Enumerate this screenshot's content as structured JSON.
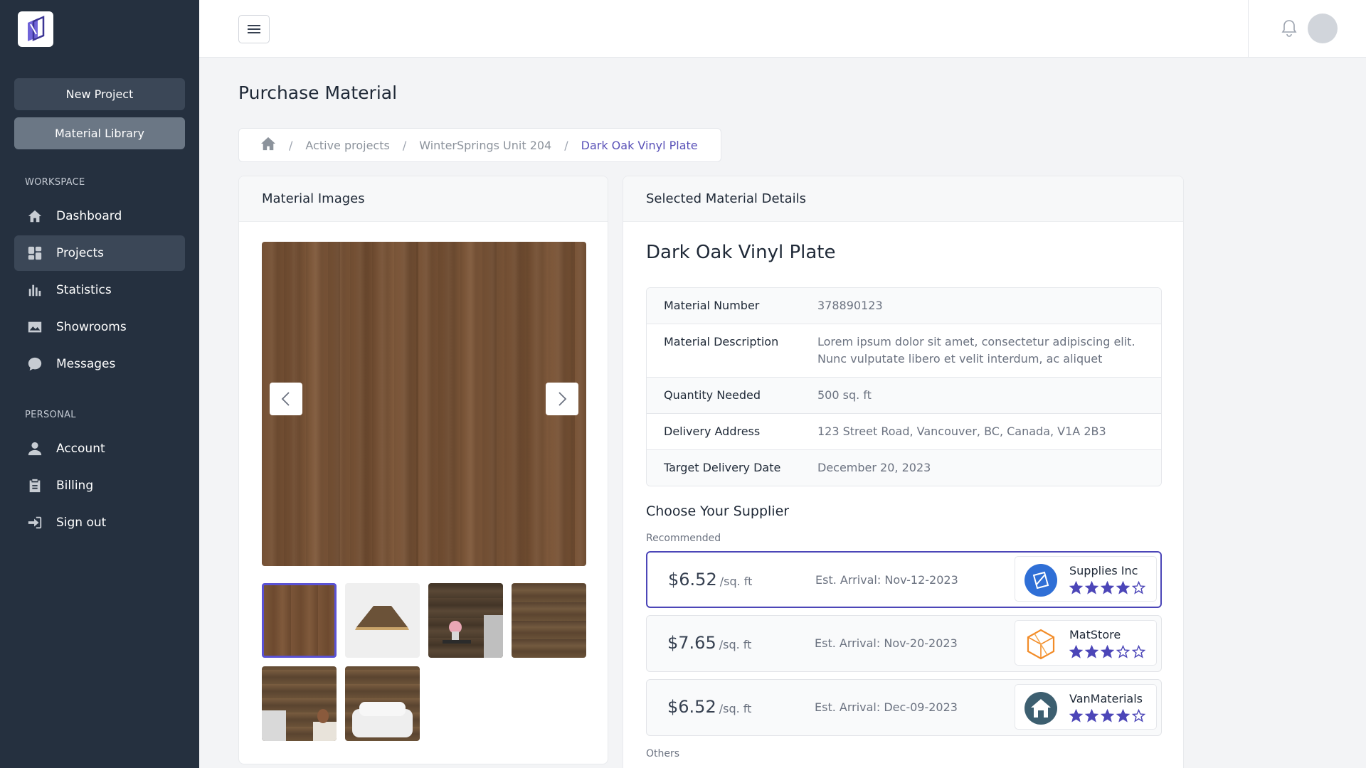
{
  "sidebar": {
    "buttons": {
      "new_project": "New Project",
      "material_library": "Material Library"
    },
    "sections": {
      "workspace": "WORKSPACE",
      "personal": "PERSONAL"
    },
    "workspace_items": [
      {
        "label": "Dashboard",
        "icon": "home-icon"
      },
      {
        "label": "Projects",
        "icon": "projects-icon",
        "active": true
      },
      {
        "label": "Statistics",
        "icon": "bar-chart-icon"
      },
      {
        "label": "Showrooms",
        "icon": "image-icon"
      },
      {
        "label": "Messages",
        "icon": "chat-icon"
      }
    ],
    "personal_items": [
      {
        "label": "Account",
        "icon": "user-icon"
      },
      {
        "label": "Billing",
        "icon": "clipboard-icon"
      },
      {
        "label": "Sign out",
        "icon": "sign-out-icon"
      }
    ]
  },
  "page": {
    "title": "Purchase Material",
    "breadcrumb": [
      "Active projects",
      "WinterSprings Unit 204",
      "Dark Oak Vinyl Plate"
    ]
  },
  "images_card": {
    "title": "Material Images"
  },
  "details_card": {
    "title": "Selected Material Details",
    "material_name": "Dark Oak Vinyl Plate",
    "rows": [
      {
        "key": "Material Number",
        "value": "378890123"
      },
      {
        "key": "Material Description",
        "value": "Lorem ipsum dolor sit amet, consectetur adipiscing elit. Nunc vulputate libero et velit interdum, ac aliquet"
      },
      {
        "key": "Quantity Needed",
        "value": "500 sq. ft"
      },
      {
        "key": "Delivery Address",
        "value": "123 Street Road, Vancouver, BC, Canada, V1A 2B3"
      },
      {
        "key": "Target Delivery Date",
        "value": "December 20, 2023"
      }
    ],
    "supplier_title": "Choose Your Supplier",
    "recommended_label": "Recommended",
    "others_label": "Others",
    "suppliers": [
      {
        "price": "$6.52",
        "unit": "/sq. ft",
        "eta": "Est. Arrival: Nov-12-2023",
        "name": "Supplies Inc",
        "rating": 4,
        "selected": true
      },
      {
        "price": "$7.65",
        "unit": "/sq. ft",
        "eta": "Est. Arrival: Nov-20-2023",
        "name": "MatStore",
        "rating": 3
      },
      {
        "price": "$6.52",
        "unit": "/sq. ft",
        "eta": "Est. Arrival: Dec-09-2023",
        "name": "VanMaterials",
        "rating": 4
      }
    ]
  },
  "colors": {
    "sidebar": "#25303f",
    "accent": "#5a52d5",
    "star": "#4c46b8"
  }
}
